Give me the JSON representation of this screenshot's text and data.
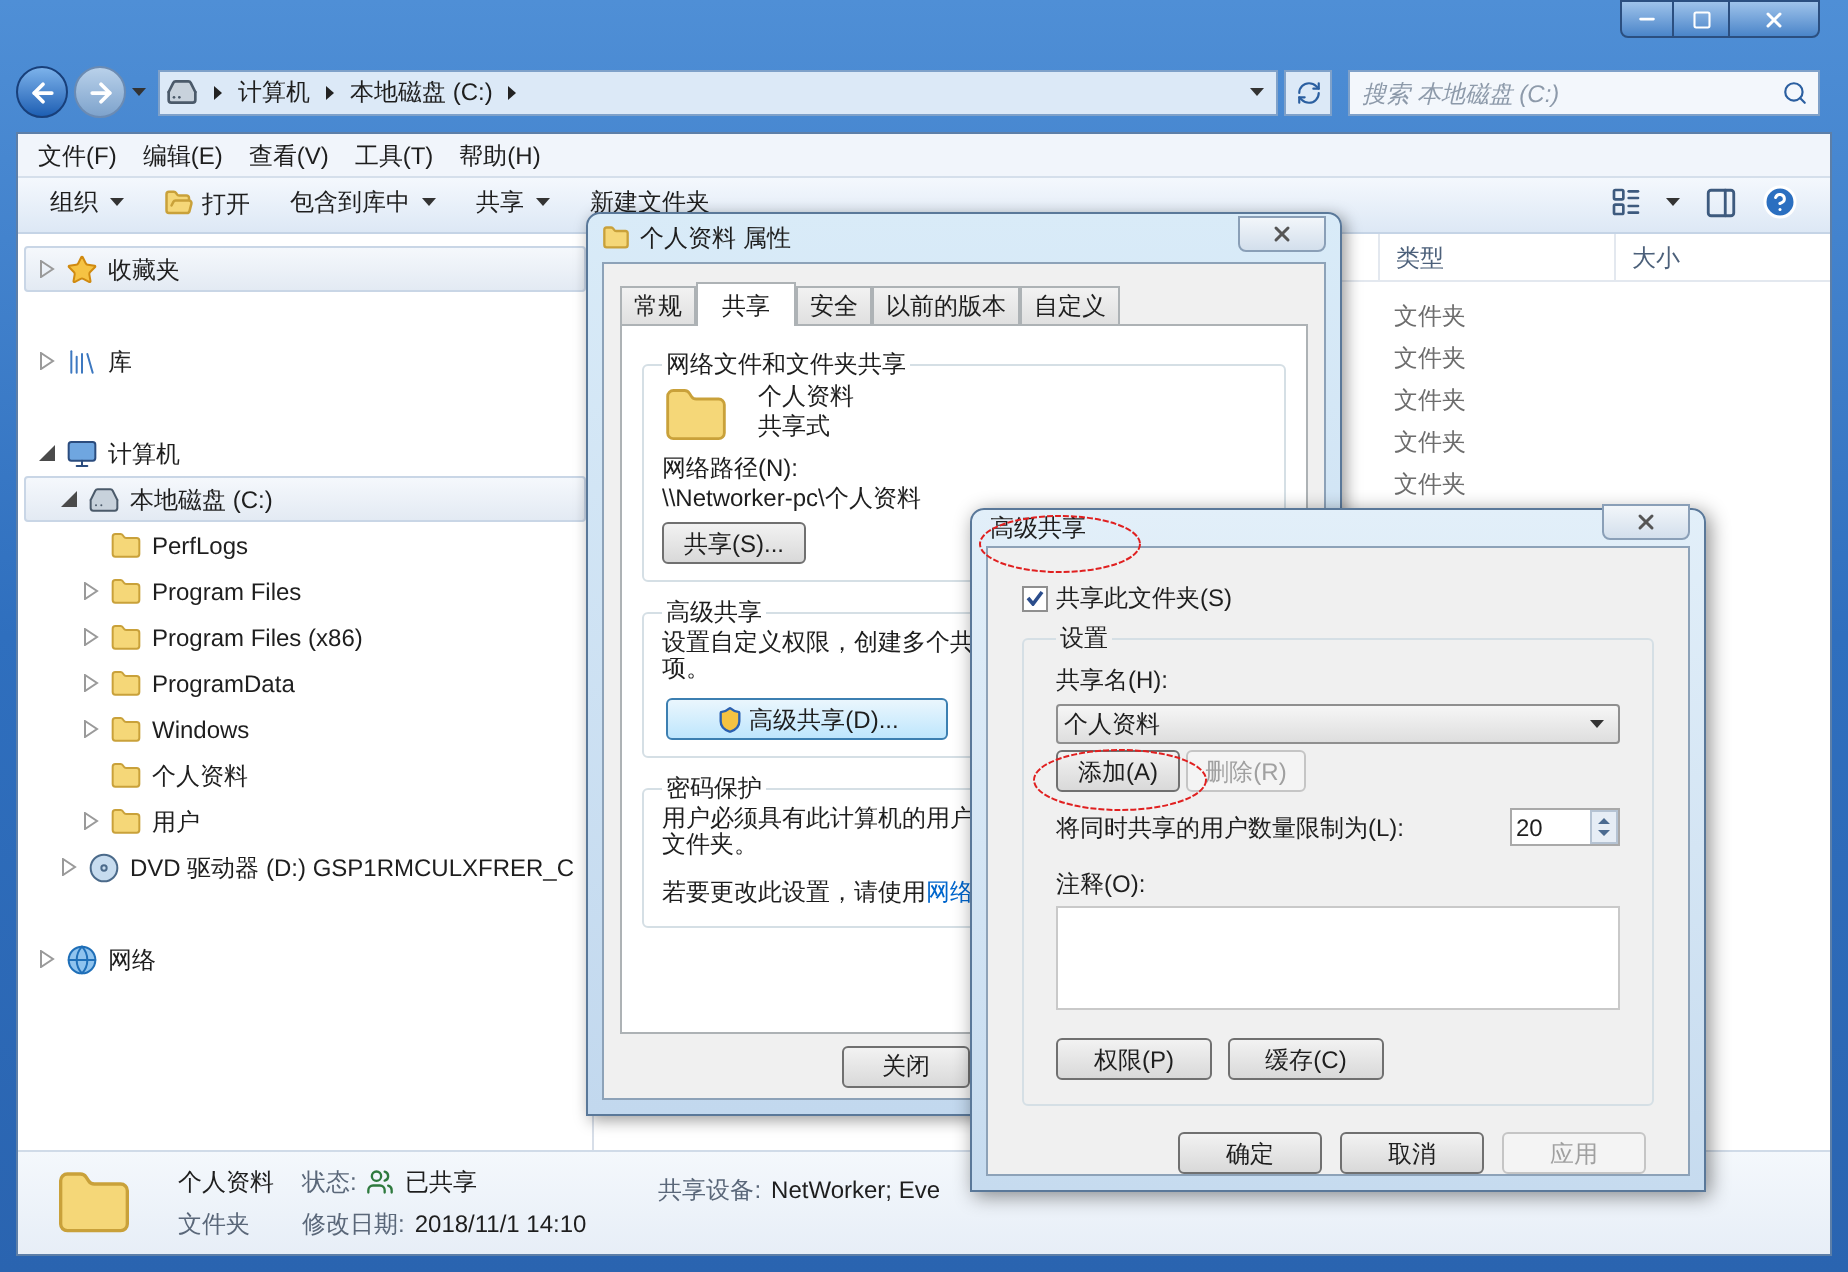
{
  "explorer": {
    "address": {
      "crumbs": [
        "计算机",
        "本地磁盘 (C:)"
      ]
    },
    "search": {
      "placeholder": "搜索 本地磁盘 (C:)"
    },
    "menu": [
      "文件(F)",
      "编辑(E)",
      "查看(V)",
      "工具(T)",
      "帮助(H)"
    ],
    "toolbar": [
      {
        "label": "组织",
        "kind": "menu"
      },
      {
        "label": "打开",
        "kind": "open"
      },
      {
        "label": "包含到库中",
        "kind": "menu"
      },
      {
        "label": "共享",
        "kind": "menu"
      },
      {
        "label": "新建文件夹",
        "kind": "plain"
      }
    ],
    "sidebar": [
      {
        "label": "收藏夹",
        "kind": "favorites",
        "expandable": true,
        "expanded": false,
        "selected": true
      },
      {
        "label": "库",
        "kind": "library",
        "expandable": true,
        "expanded": false,
        "selected": false
      },
      {
        "label": "计算机",
        "kind": "computer",
        "expandable": true,
        "expanded": true,
        "selected": false,
        "children": [
          {
            "label": "本地磁盘 (C:)",
            "kind": "drive",
            "expandable": true,
            "expanded": true,
            "selected": true,
            "children": [
              {
                "label": "PerfLogs",
                "kind": "folder",
                "expandable": false,
                "selected": false
              },
              {
                "label": "Program Files",
                "kind": "folder",
                "expandable": true,
                "expanded": false,
                "selected": false
              },
              {
                "label": "Program Files (x86)",
                "kind": "folder",
                "expandable": true,
                "expanded": false,
                "selected": false
              },
              {
                "label": "ProgramData",
                "kind": "folder",
                "expandable": true,
                "expanded": false,
                "selected": false
              },
              {
                "label": "Windows",
                "kind": "folder",
                "expandable": true,
                "expanded": false,
                "selected": false
              },
              {
                "label": "个人资料",
                "kind": "folder",
                "expandable": false,
                "selected": false
              },
              {
                "label": "用户",
                "kind": "folder",
                "expandable": true,
                "expanded": false,
                "selected": false
              }
            ]
          },
          {
            "label": "DVD 驱动器 (D:) GSP1RMCULXFRER_C",
            "kind": "dvd",
            "expandable": true,
            "expanded": false,
            "selected": false
          }
        ]
      },
      {
        "label": "网络",
        "kind": "network",
        "expandable": true,
        "expanded": false,
        "selected": false
      }
    ],
    "file_list": {
      "columns": [
        "类型",
        "大小"
      ],
      "rows": [
        "文件夹",
        "文件夹",
        "文件夹",
        "文件夹",
        "文件夹"
      ]
    },
    "status_bar": {
      "name": "个人资料",
      "type": "文件夹",
      "state_label": "状态:",
      "state_value": "已共享",
      "date_label": "修改日期:",
      "date_value": "2018/11/1 14:10",
      "shared_label": "共享设备:",
      "shared_value": "NetWorker; Eve"
    }
  },
  "properties_dialog": {
    "title": "个人资料 属性",
    "tabs": [
      {
        "label": "常规",
        "selected": false
      },
      {
        "label": "共享",
        "selected": true
      },
      {
        "label": "安全",
        "selected": false
      },
      {
        "label": "以前的版本",
        "selected": false
      },
      {
        "label": "自定义",
        "selected": false
      }
    ],
    "network_sharing": {
      "legend": "网络文件和文件夹共享",
      "name": "个人资料",
      "state": "共享式",
      "path_label": "网络路径(N):",
      "path": "\\\\Networker-pc\\个人资料",
      "button": "共享(S)..."
    },
    "advanced": {
      "legend": "高级共享",
      "lines": [
        "设置自定义权限，创建多个共",
        "项。"
      ],
      "button": "高级共享(D)..."
    },
    "password": {
      "legend": "密码保护",
      "lines": [
        "用户必须具有此计算机的用户",
        "文件夹。"
      ],
      "change_text": "若要更改此设置，请使用",
      "link": "网络"
    },
    "close_button": "关闭"
  },
  "advanced_sharing_dialog": {
    "title": "高级共享",
    "share_checkbox": {
      "label": "共享此文件夹(S)",
      "checked": true
    },
    "settings_legend": "设置",
    "share_name_label": "共享名(H):",
    "share_name": "个人资料",
    "add_button": {
      "label": "添加(A)",
      "disabled": false
    },
    "remove_button": {
      "label": "删除(R)",
      "disabled": true
    },
    "limit_label": "将同时共享的用户数量限制为(L):",
    "limit": "20",
    "comment_label": "注释(O):",
    "permissions_button": "权限(P)",
    "caching_button": "缓存(C)",
    "buttons": [
      {
        "label": "确定",
        "disabled": false
      },
      {
        "label": "取消",
        "disabled": false
      },
      {
        "label": "应用",
        "disabled": true
      }
    ]
  }
}
